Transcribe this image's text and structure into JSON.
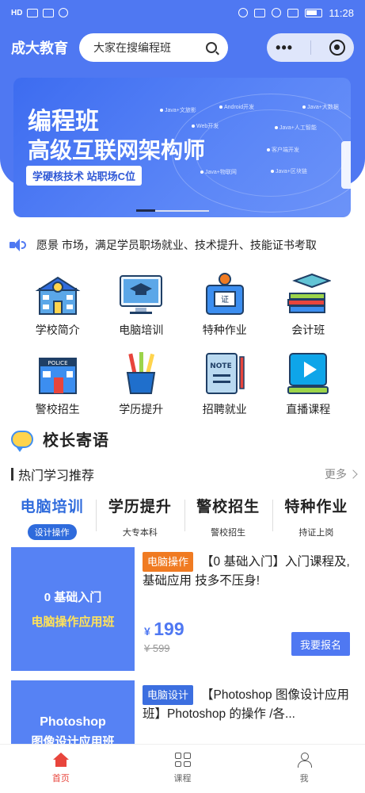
{
  "status_bar": {
    "time": "11:28",
    "left": "HD"
  },
  "header": {
    "brand": "成大教育",
    "search_placeholder": "大家在搜编程班",
    "more": "•••"
  },
  "banner": {
    "line1": "编程班",
    "line2": "高级互联网架构师",
    "tag": "学硬核技术 站职场C位",
    "nodes": [
      "Java+文旅影",
      "Android开发",
      "Java+大数据",
      "Web开发",
      "Java+人工智能",
      "客户端开发",
      "Java+物联网",
      "Java+区块链"
    ]
  },
  "notice": {
    "text": "愿景 市场，满足学员职场就业、技术提升、技能证书考取"
  },
  "categories": [
    {
      "label": "学校简介",
      "icon": "school-building-icon"
    },
    {
      "label": "电脑培训",
      "icon": "computer-monitor-icon"
    },
    {
      "label": "特种作业",
      "icon": "certificate-badge-icon"
    },
    {
      "label": "会计班",
      "icon": "books-cap-icon"
    },
    {
      "label": "警校招生",
      "icon": "police-station-icon"
    },
    {
      "label": "学历提升",
      "icon": "pen-holder-icon"
    },
    {
      "label": "招聘就业",
      "icon": "notebook-icon"
    },
    {
      "label": "直播课程",
      "icon": "play-screen-icon"
    }
  ],
  "principal": {
    "title": "校长寄语"
  },
  "hot": {
    "title": "热门学习推荐",
    "more": "更多"
  },
  "tabs": [
    {
      "name": "电脑培训",
      "sub": "设计操作"
    },
    {
      "name": "学历提升",
      "sub": "大专本科"
    },
    {
      "name": "警校招生",
      "sub": "警校招生"
    },
    {
      "name": "特种作业",
      "sub": "持证上岗"
    }
  ],
  "courses": [
    {
      "thumb_line1": "0 基础入门",
      "thumb_line2": "电脑操作应用班",
      "tag": "电脑操作",
      "tag_color": "#f07b22",
      "title": "【0 基础入门】入门课程及,基础应用 技多不压身!",
      "price_symbol": "¥",
      "price": "199",
      "old_price": "¥ 599",
      "enroll": "我要报名"
    },
    {
      "thumb_line1": "Photoshop",
      "thumb_line2": "图像设计应用班",
      "tag": "电脑设计",
      "tag_color": "#3c6fe0",
      "title": "【Photoshop 图像设计应用班】Photoshop 的操作 /各..."
    }
  ],
  "bottom_nav": [
    {
      "label": "首页",
      "icon": "home-icon"
    },
    {
      "label": "课程",
      "icon": "course-grid-icon"
    },
    {
      "label": "我",
      "icon": "user-icon"
    }
  ],
  "colors": {
    "primary": "#4f78f2",
    "accent_red": "#e8453c",
    "tab_active": "#2f6bdc"
  }
}
